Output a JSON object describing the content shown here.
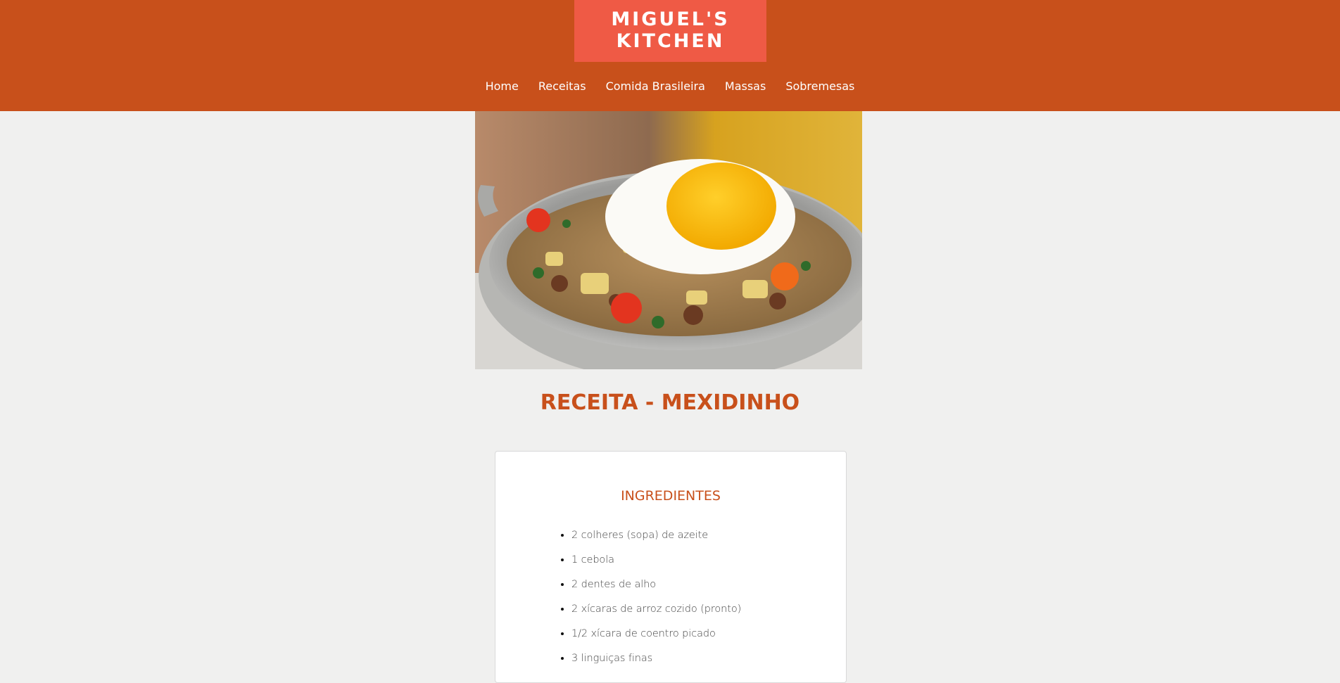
{
  "header": {
    "logo_line1": "MIGUEL'S",
    "logo_line2": "KITCHEN",
    "nav": [
      "Home",
      "Receitas",
      "Comida Brasileira",
      "Massas",
      "Sobremesas"
    ]
  },
  "main": {
    "title": "RECEITA - MEXIDINHO",
    "ingredients_heading": "INGREDIENTES",
    "ingredients": [
      "2 colheres (sopa) de azeite",
      "1 cebola",
      "2 dentes de alho",
      "2 xícaras de arroz cozido (pronto)",
      "1/2 xícara de coentro picado",
      "3 linguiças finas"
    ]
  },
  "colors": {
    "header_bg": "#c8501b",
    "logo_bg": "#ef5a45",
    "accent": "#c8501b",
    "page_bg": "#f0f0ef"
  }
}
